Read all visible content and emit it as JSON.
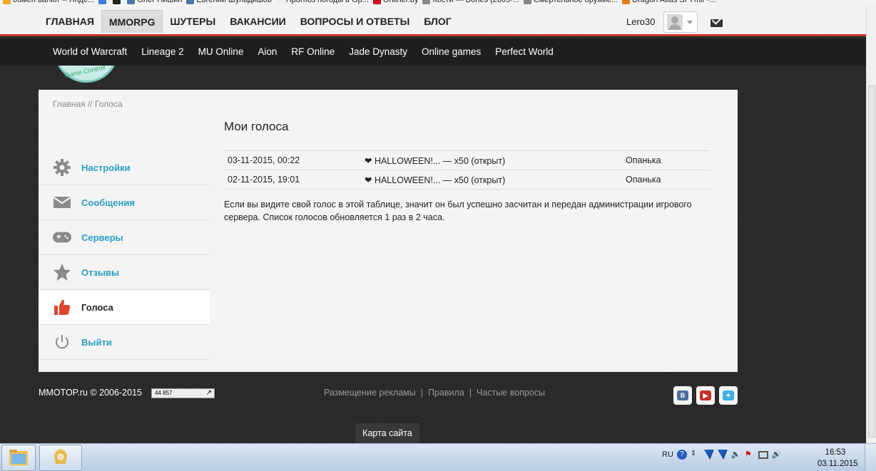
{
  "bookmarks": [
    "обмен валют – Янде...",
    "",
    "",
    "Олег Нишин",
    "Евгений Шульдишов",
    "Прогноз погоды в Ор...",
    "Onliner.by",
    "Кости — Bones (2005-...",
    "Смертельное оружие...",
    "Dragon Atlas SI Ymir -..."
  ],
  "topnav": {
    "items": [
      "ГЛАВНАЯ",
      "MMORPG",
      "ШУТЕРЫ",
      "ВАКАНСИИ",
      "ВОПРОСЫ И ОТВЕТЫ",
      "БЛОГ"
    ],
    "active_index": 1,
    "username": "Lero30"
  },
  "subnav": [
    "World of Warcraft",
    "Lineage 2",
    "MU Online",
    "Aion",
    "RF Online",
    "Jade Dynasty",
    "Online games",
    "Perfect World"
  ],
  "logo_text": "Game Controll",
  "breadcrumb": {
    "home": "Главная",
    "sep": " // ",
    "current": "Голоса"
  },
  "sidebar": [
    {
      "label": "Настройки",
      "icon": "gear-icon"
    },
    {
      "label": "Сообщения",
      "icon": "envelope-icon"
    },
    {
      "label": "Серверы",
      "icon": "gamepad-icon"
    },
    {
      "label": "Отзывы",
      "icon": "star-icon"
    },
    {
      "label": "Голоса",
      "icon": "thumbs-up-icon",
      "active": true
    },
    {
      "label": "Выйти",
      "icon": "power-icon"
    }
  ],
  "page_title": "Мои голоса",
  "votes": [
    {
      "date": "03-11-2015, 00:22",
      "server": "❤ HALLOWEEN!... — x50 (открыт)",
      "user": "Опанька"
    },
    {
      "date": "02-11-2015, 19:01",
      "server": "❤ HALLOWEEN!... — x50 (открыт)",
      "user": "Опанька"
    }
  ],
  "note": "Если вы видите свой голос в этой таблице, значит он был успешно засчитан и передан администрации игрового сервера. Список голосов обновляется 1 раз в 2 часа.",
  "footer": {
    "copyright": "MMOTOP.ru © 2006-2015",
    "counter": "44 857",
    "links": [
      "Размещение рекламы",
      "Правила",
      "Частые вопросы"
    ],
    "sitemap": "Карта сайта"
  },
  "social": [
    {
      "name": "vk",
      "glyph": "В",
      "color": "#4a6e9b"
    },
    {
      "name": "youtube",
      "glyph": "▶",
      "color": "#c4302b"
    },
    {
      "name": "twitter",
      "glyph": "✦",
      "color": "#3fb0e8"
    }
  ],
  "taskbar": {
    "lang": "RU",
    "time": "16:53",
    "date": "03.11.2015"
  },
  "colors": {
    "accent_red": "#c8332a",
    "link_blue": "#2a9ec4",
    "dark_bar": "#1e1e1e"
  }
}
